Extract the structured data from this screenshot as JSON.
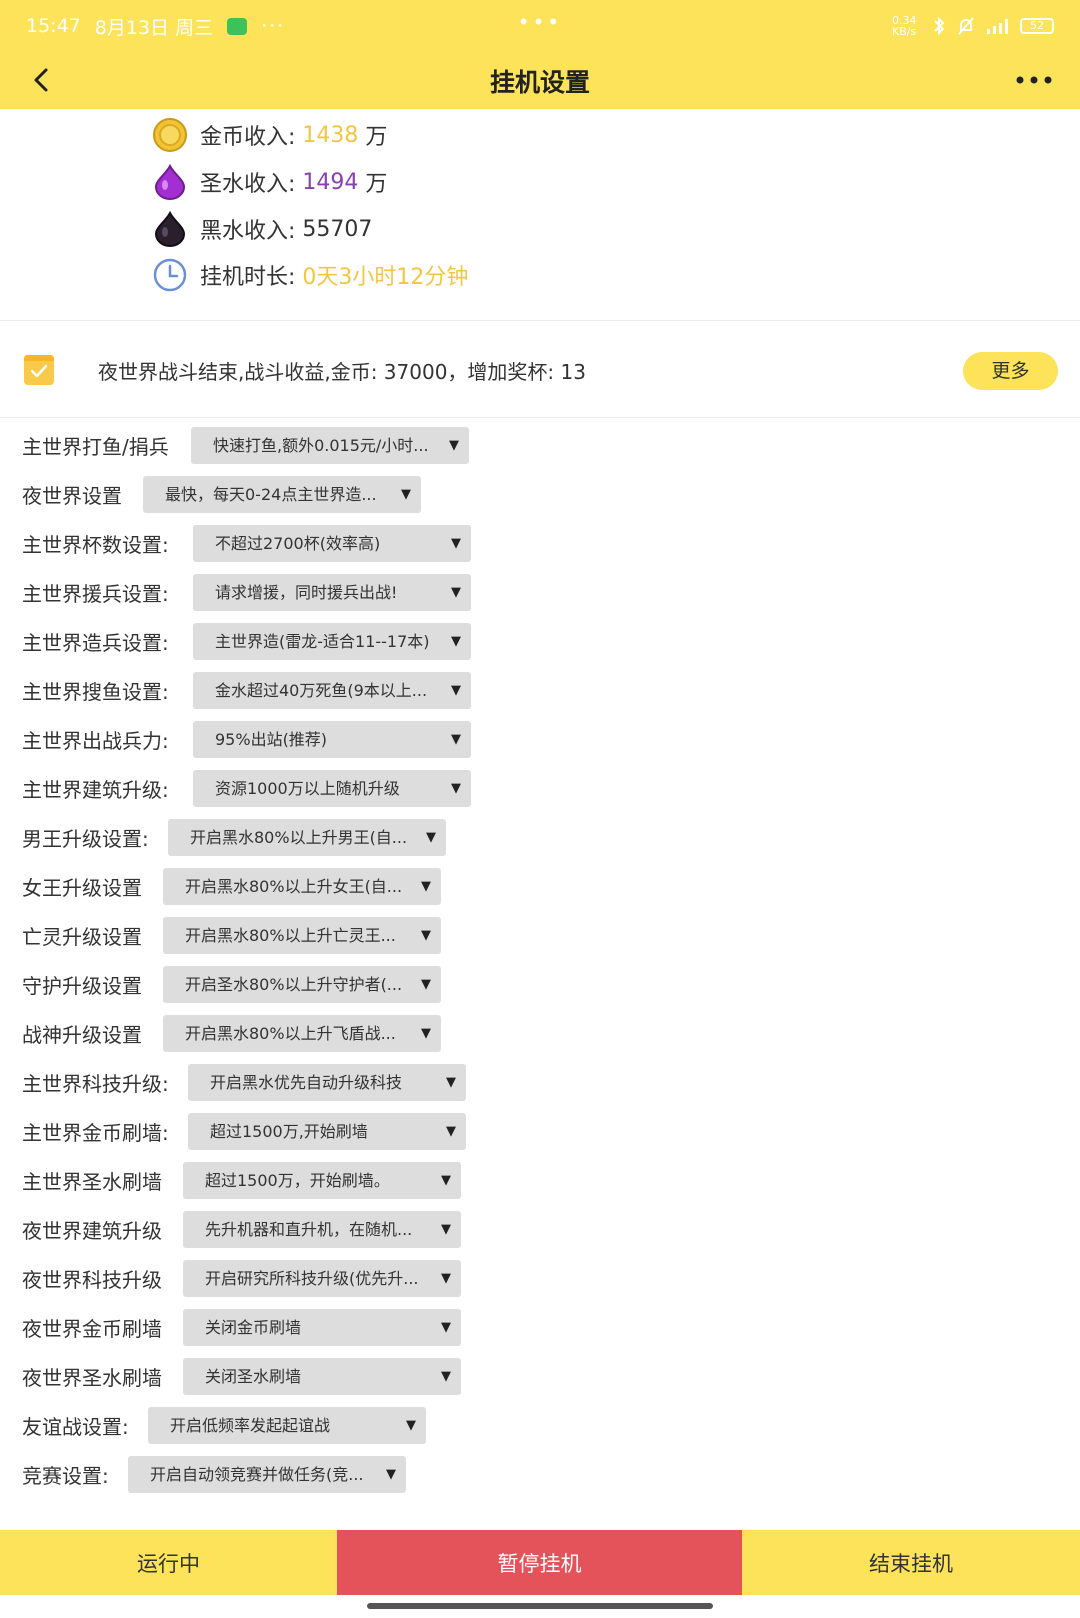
{
  "status_bar": {
    "time": "15:47",
    "date": "8月13日 周三",
    "more_dots": "···",
    "net_speed": "0.34 KB/s",
    "battery": "52"
  },
  "header": {
    "title": "挂机设置"
  },
  "income": {
    "gold": {
      "label": "金币收入:",
      "value": "1438",
      "unit": "万"
    },
    "elixir": {
      "label": "圣水收入:",
      "value": "1494",
      "unit": "万"
    },
    "dark": {
      "label": "黑水收入:",
      "value": "55707"
    },
    "duration": {
      "label": "挂机时长:",
      "value": "0天3小时12分钟"
    }
  },
  "log": {
    "message": "夜世界战斗结束,战斗收益,金币: 37000，增加奖杯: 13",
    "more_label": "更多"
  },
  "settings": [
    {
      "label": "主世界打鱼/捐兵",
      "value": "快速打鱼,额外0.015元/小时..."
    },
    {
      "label": "夜世界设置",
      "value": "最快，每天0-24点主世界造..."
    },
    {
      "label": "主世界杯数设置:",
      "value": "不超过2700杯(效率高)"
    },
    {
      "label": "主世界援兵设置:",
      "value": "请求增援，同时援兵出战!"
    },
    {
      "label": "主世界造兵设置:",
      "value": "主世界造(雷龙-适合11--17本)"
    },
    {
      "label": "主世界搜鱼设置:",
      "value": "金水超过40万死鱼(9本以上..."
    },
    {
      "label": "主世界出战兵力:",
      "value": "95%出站(推荐)"
    },
    {
      "label": "主世界建筑升级:",
      "value": "资源1000万以上随机升级"
    },
    {
      "label": "男王升级设置:",
      "value": "开启黑水80%以上升男王(自..."
    },
    {
      "label": "女王升级设置",
      "value": "开启黑水80%以上升女王(自..."
    },
    {
      "label": "亡灵升级设置",
      "value": "开启黑水80%以上升亡灵王..."
    },
    {
      "label": "守护升级设置",
      "value": "开启圣水80%以上升守护者(..."
    },
    {
      "label": "战神升级设置",
      "value": "开启黑水80%以上升飞盾战..."
    },
    {
      "label": "主世界科技升级:",
      "value": "开启黑水优先自动升级科技"
    },
    {
      "label": "主世界金币刷墙:",
      "value": "超过1500万,开始刷墙"
    },
    {
      "label": "主世界圣水刷墙",
      "value": "超过1500万，开始刷墙。"
    },
    {
      "label": "夜世界建筑升级",
      "value": "先升机器和直升机，在随机..."
    },
    {
      "label": "夜世界科技升级",
      "value": "开启研究所科技升级(优先升..."
    },
    {
      "label": "夜世界金币刷墙",
      "value": "关闭金币刷墙"
    },
    {
      "label": "夜世界圣水刷墙",
      "value": "关闭圣水刷墙"
    },
    {
      "label": "友谊战设置:",
      "value": "开启低频率发起起谊战"
    },
    {
      "label": "竞赛设置:",
      "value": "开启自动领竞赛并做任务(竞..."
    }
  ],
  "dropdown_arrow": "▼",
  "bottom": {
    "running": "运行中",
    "pause": "暂停挂机",
    "end": "结束挂机"
  },
  "colors": {
    "accent_yellow": "#fde35a",
    "pause_red": "#e4535a",
    "gold_text": "#f4c542",
    "elixir_text": "#8a3fb0"
  }
}
